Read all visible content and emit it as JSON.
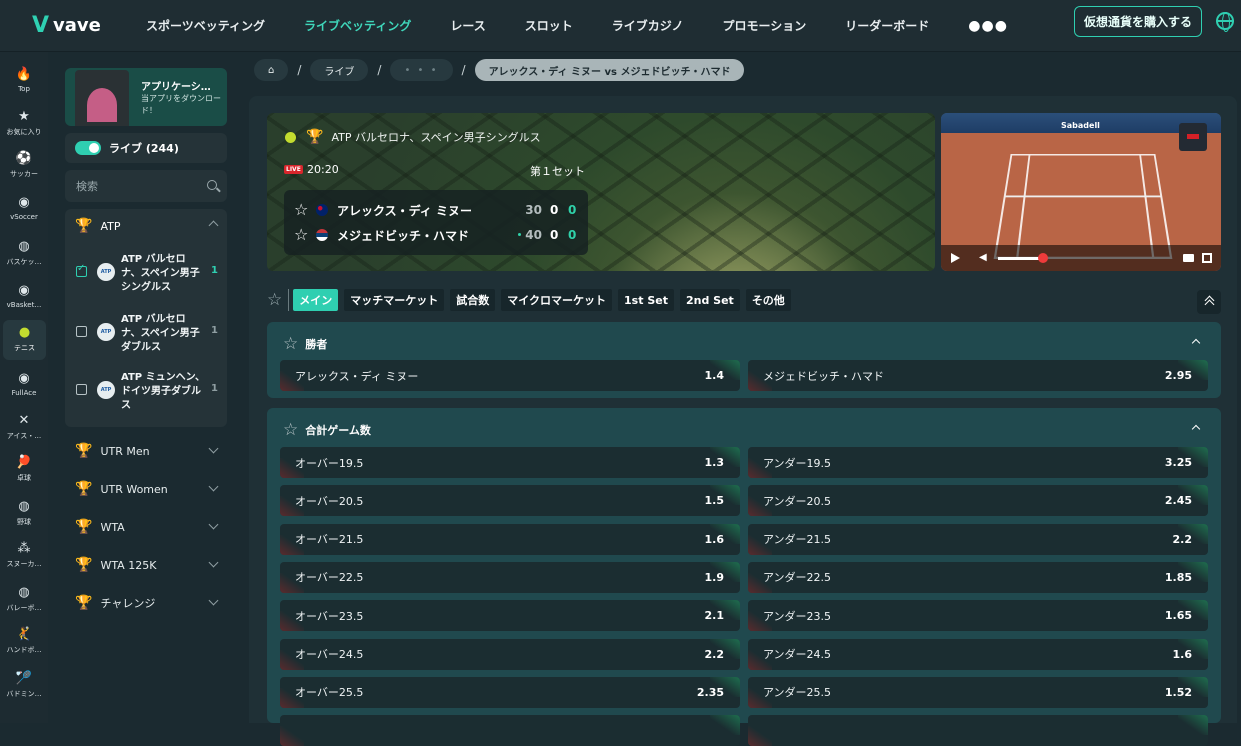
{
  "brand": {
    "name": "vave"
  },
  "nav": [
    "スポーツベッティング",
    "ライブベッティング",
    "レース",
    "スロット",
    "ライブカジノ",
    "プロモーション",
    "リーダーボード"
  ],
  "nav_more": "●●●",
  "nav_active_index": 1,
  "buy_crypto": "仮想通貨を購入する",
  "rail": [
    {
      "label": "Top",
      "icon": "fire-icon",
      "glyph": "🔥"
    },
    {
      "label": "お気に入り",
      "icon": "star-icon",
      "glyph": "★"
    },
    {
      "label": "サッカー",
      "icon": "soccer-icon",
      "glyph": "⚽"
    },
    {
      "label": "vSoccer",
      "icon": "vsoccer-icon",
      "glyph": "◉"
    },
    {
      "label": "バスケッ…",
      "icon": "basketball-icon",
      "glyph": "◍"
    },
    {
      "label": "vBasket…",
      "icon": "vbasket-icon",
      "glyph": "◉"
    },
    {
      "label": "テニス",
      "icon": "tennis-icon",
      "glyph": "●"
    },
    {
      "label": "FullAce",
      "icon": "fullace-icon",
      "glyph": "◉"
    },
    {
      "label": "アイス・…",
      "icon": "ice-hockey-icon",
      "glyph": "✕"
    },
    {
      "label": "卓球",
      "icon": "table-tennis-icon",
      "glyph": "🏓"
    },
    {
      "label": "野球",
      "icon": "baseball-icon",
      "glyph": "◍"
    },
    {
      "label": "スヌーカ…",
      "icon": "snooker-icon",
      "glyph": "⁂"
    },
    {
      "label": "バレーボ…",
      "icon": "volleyball-icon",
      "glyph": "◍"
    },
    {
      "label": "ハンドボ…",
      "icon": "handball-icon",
      "glyph": "🤾"
    },
    {
      "label": "バドミン…",
      "icon": "badminton-icon",
      "glyph": "🏸"
    }
  ],
  "rail_active_index": 6,
  "app_promo": {
    "title": "アプリケーシ…",
    "subtitle": "当アプリをダウンロード！"
  },
  "live_toggle": {
    "label": "ライブ (244)",
    "on": true
  },
  "search": {
    "placeholder": "検索"
  },
  "league_group": {
    "name": "ATP",
    "leagues": [
      {
        "name": "ATP バルセロナ、スペイン男子シングルス",
        "count": "1",
        "checked": true,
        "badge": "ATP"
      },
      {
        "name": "ATP バルセロナ、スペイン男子ダブルス",
        "count": "1",
        "checked": false,
        "badge": "ATP"
      },
      {
        "name": "ATP ミュンヘン、ドイツ男子ダブルス",
        "count": "1",
        "checked": false,
        "badge": "ATP"
      }
    ]
  },
  "categories": [
    "UTR Men",
    "UTR Women",
    "WTA",
    "WTA 125K",
    "チャレンジ"
  ],
  "breadcrumbs": {
    "home": "home-icon",
    "live": "ライブ",
    "more": "• • •",
    "current": "アレックス・ディ ミヌー vs メジェドビッチ・ハマド"
  },
  "match": {
    "tournament": "ATP バルセロナ、スペイン男子シングルス",
    "live_badge": "LIVE",
    "time": "20:20",
    "period": "第１セット",
    "players": [
      {
        "name": "アレックス・ディ ミヌー",
        "points": "30",
        "sets": "0",
        "games": "0",
        "serving": false
      },
      {
        "name": "メジェドビッチ・ハマド",
        "points": "40",
        "sets": "0",
        "games": "0",
        "serving": true
      }
    ],
    "video_banner": "Sabadell",
    "volume": 0.85
  },
  "tabs": [
    "メイン",
    "マッチマーケット",
    "試合数",
    "マイクロマーケット",
    "1st Set",
    "2nd Set",
    "その他"
  ],
  "tab_active_index": 0,
  "markets": [
    {
      "title": "勝者",
      "rows": [
        [
          {
            "label": "アレックス・ディ ミヌー",
            "price": "1.4"
          },
          {
            "label": "メジェドビッチ・ハマド",
            "price": "2.95"
          }
        ]
      ]
    },
    {
      "title": "合計ゲーム数",
      "rows": [
        [
          {
            "label": "オーバー19.5",
            "price": "1.3"
          },
          {
            "label": "アンダー19.5",
            "price": "3.25"
          }
        ],
        [
          {
            "label": "オーバー20.5",
            "price": "1.5"
          },
          {
            "label": "アンダー20.5",
            "price": "2.45"
          }
        ],
        [
          {
            "label": "オーバー21.5",
            "price": "1.6"
          },
          {
            "label": "アンダー21.5",
            "price": "2.2"
          }
        ],
        [
          {
            "label": "オーバー22.5",
            "price": "1.9"
          },
          {
            "label": "アンダー22.5",
            "price": "1.85"
          }
        ],
        [
          {
            "label": "オーバー23.5",
            "price": "2.1"
          },
          {
            "label": "アンダー23.5",
            "price": "1.65"
          }
        ],
        [
          {
            "label": "オーバー24.5",
            "price": "2.2"
          },
          {
            "label": "アンダー24.5",
            "price": "1.6"
          }
        ],
        [
          {
            "label": "オーバー25.5",
            "price": "2.35"
          },
          {
            "label": "アンダー25.5",
            "price": "1.52"
          }
        ]
      ]
    }
  ]
}
